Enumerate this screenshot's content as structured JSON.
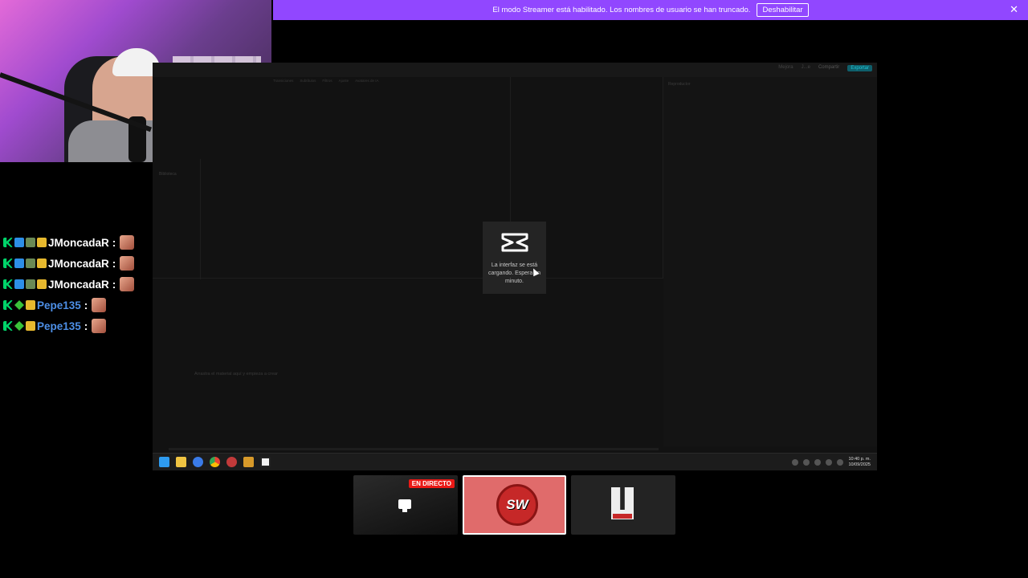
{
  "banner": {
    "message": "El modo Streamer está habilitado. Los nombres de usuario se han truncado.",
    "button": "Deshabilitar",
    "close": "✕",
    "bg_color": "#9147ff"
  },
  "chat": {
    "messages": [
      {
        "user": "JMoncadaR",
        "sep": ":"
      },
      {
        "user": "JMoncadaR",
        "sep": ":"
      },
      {
        "user": "JMoncadaR",
        "sep": ":"
      },
      {
        "user": "Pepe135",
        "sep": ":"
      },
      {
        "user": "Pepe135",
        "sep": ":"
      }
    ]
  },
  "capcut": {
    "media_tabs": [
      "Transiciones",
      "Subtítulos",
      "Filtros",
      "Ajuste",
      "Avatares de IA"
    ],
    "library_label": "Biblioteca",
    "player_label": "Reproductor",
    "drop_hint": "Arrastra el material aquí y empieza a crear",
    "header_items": [
      "Mejora",
      "J...e",
      "Compartir",
      "Exportar"
    ],
    "loading_message": "La interfaz se está cargando. Espera un minuto."
  },
  "taskbar": {
    "time": "10:40 p. m.",
    "date": "10/09/2025"
  },
  "scenes": {
    "live_label": "EN DIRECTO",
    "sw_text": "SW"
  }
}
